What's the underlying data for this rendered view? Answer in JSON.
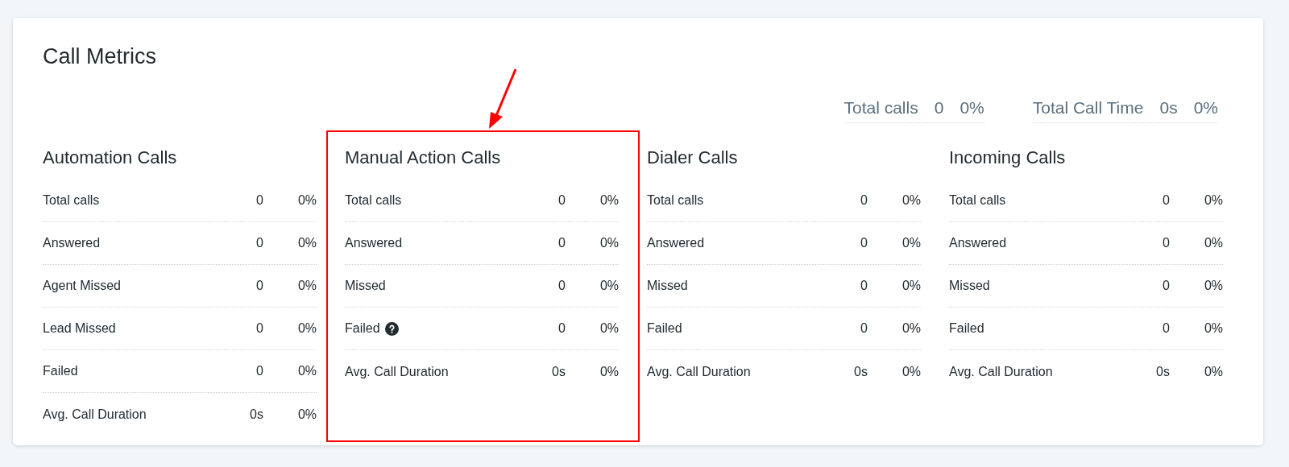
{
  "title": "Call Metrics",
  "totals": [
    {
      "label": "Total calls",
      "value": "0",
      "percent": "0%"
    },
    {
      "label": "Total Call Time",
      "value": "0s",
      "percent": "0%"
    }
  ],
  "groups": [
    {
      "title": "Automation Calls",
      "highlighted": false,
      "rows": [
        {
          "label": "Total calls",
          "value": "0",
          "percent": "0%",
          "help": false
        },
        {
          "label": "Answered",
          "value": "0",
          "percent": "0%",
          "help": false
        },
        {
          "label": "Agent Missed",
          "value": "0",
          "percent": "0%",
          "help": false
        },
        {
          "label": "Lead Missed",
          "value": "0",
          "percent": "0%",
          "help": false
        },
        {
          "label": "Failed",
          "value": "0",
          "percent": "0%",
          "help": false
        },
        {
          "label": "Avg. Call Duration",
          "value": "0s",
          "percent": "0%",
          "help": false
        }
      ]
    },
    {
      "title": "Manual Action Calls",
      "highlighted": true,
      "rows": [
        {
          "label": "Total calls",
          "value": "0",
          "percent": "0%",
          "help": false
        },
        {
          "label": "Answered",
          "value": "0",
          "percent": "0%",
          "help": false
        },
        {
          "label": "Missed",
          "value": "0",
          "percent": "0%",
          "help": false
        },
        {
          "label": "Failed",
          "value": "0",
          "percent": "0%",
          "help": true
        },
        {
          "label": "Avg. Call Duration",
          "value": "0s",
          "percent": "0%",
          "help": false
        }
      ]
    },
    {
      "title": "Dialer Calls",
      "highlighted": false,
      "rows": [
        {
          "label": "Total calls",
          "value": "0",
          "percent": "0%",
          "help": false
        },
        {
          "label": "Answered",
          "value": "0",
          "percent": "0%",
          "help": false
        },
        {
          "label": "Missed",
          "value": "0",
          "percent": "0%",
          "help": false
        },
        {
          "label": "Failed",
          "value": "0",
          "percent": "0%",
          "help": false
        },
        {
          "label": "Avg. Call Duration",
          "value": "0s",
          "percent": "0%",
          "help": false
        }
      ]
    },
    {
      "title": "Incoming Calls",
      "highlighted": false,
      "rows": [
        {
          "label": "Total calls",
          "value": "0",
          "percent": "0%",
          "help": false
        },
        {
          "label": "Answered",
          "value": "0",
          "percent": "0%",
          "help": false
        },
        {
          "label": "Missed",
          "value": "0",
          "percent": "0%",
          "help": false
        },
        {
          "label": "Failed",
          "value": "0",
          "percent": "0%",
          "help": false
        },
        {
          "label": "Avg. Call Duration",
          "value": "0s",
          "percent": "0%",
          "help": false
        }
      ]
    }
  ]
}
